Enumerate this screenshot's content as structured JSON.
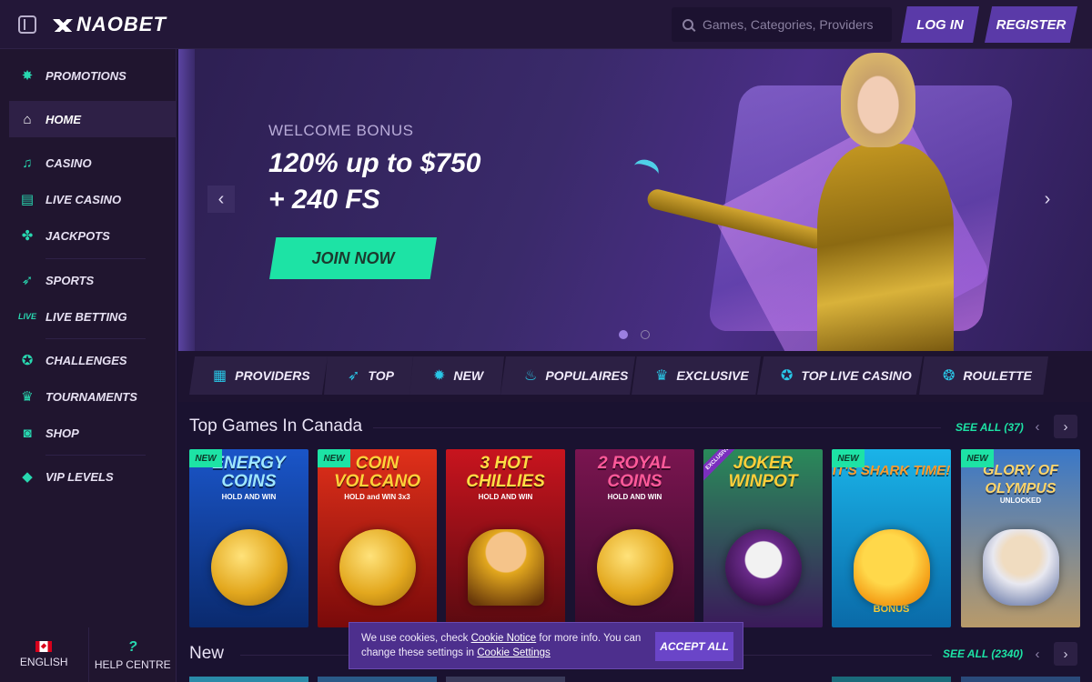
{
  "header": {
    "logo": "NAOBET",
    "search_placeholder": "Games, Categories, Providers",
    "login": "LOG IN",
    "register": "REGISTER"
  },
  "sidebar": {
    "items": [
      {
        "label": "PROMOTIONS",
        "icon": "promotions-icon"
      },
      {
        "label": "HOME",
        "icon": "home-icon"
      },
      {
        "label": "CASINO",
        "icon": "music-note-icon"
      },
      {
        "label": "LIVE CASINO",
        "icon": "cards-icon"
      },
      {
        "label": "JACKPOTS",
        "icon": "clover-icon"
      },
      {
        "label": "SPORTS",
        "icon": "sneaker-icon"
      },
      {
        "label": "LIVE BETTING",
        "icon": "live-icon"
      },
      {
        "label": "CHALLENGES",
        "icon": "medal-icon"
      },
      {
        "label": "TOURNAMENTS",
        "icon": "trophy-icon"
      },
      {
        "label": "SHOP",
        "icon": "shopping-bag-icon"
      },
      {
        "label": "VIP LEVELS",
        "icon": "diamond-icon"
      }
    ],
    "footer": {
      "language": "ENGLISH",
      "help": "HELP CENTRE"
    }
  },
  "hero": {
    "kicker": "WELCOME BONUS",
    "title_line1": "120% up to $750",
    "title_line2": "+ 240 FS",
    "cta": "JOIN NOW",
    "slide": 1,
    "slides": 2
  },
  "categories": [
    {
      "label": "PROVIDERS",
      "icon": "grid-icon"
    },
    {
      "label": "TOP",
      "icon": "rocket-icon"
    },
    {
      "label": "NEW",
      "icon": "new-badge-icon"
    },
    {
      "label": "POPULAIRES",
      "icon": "flame-icon"
    },
    {
      "label": "EXCLUSIVE",
      "icon": "crown-icon"
    },
    {
      "label": "TOP LIVE CASINO",
      "icon": "chip-icon"
    },
    {
      "label": "ROULETTE",
      "icon": "roulette-icon"
    }
  ],
  "sections": {
    "top": {
      "title": "Top Games In Canada",
      "see_all": "SEE ALL (37)"
    },
    "new": {
      "title": "New",
      "see_all": "SEE ALL (2340)"
    }
  },
  "games": [
    {
      "name": "ENERGY COINS",
      "sub": "HOLD AND WIN",
      "badge": "NEW",
      "colors": [
        "#1a55c8",
        "#0a2a6e"
      ],
      "title_color": "#9fe7ff"
    },
    {
      "name": "COIN VOLCANO",
      "sub": "HOLD and WIN 3x3",
      "badge": "NEW",
      "colors": [
        "#e0301a",
        "#7a0a0a"
      ],
      "title_color": "#ffd23a"
    },
    {
      "name": "3 HOT CHILLIES",
      "sub": "HOLD AND WIN",
      "badge": "",
      "colors": [
        "#c8141e",
        "#5a0a10"
      ],
      "title_color": "#ffdd44"
    },
    {
      "name": "2 ROYAL COINS",
      "sub": "HOLD AND WIN",
      "badge": "",
      "colors": [
        "#7a1550",
        "#3a0a2a"
      ],
      "title_color": "#ff5a9a"
    },
    {
      "name": "JOKER WINPOT",
      "sub": "",
      "badge": "EXCLUSIVE",
      "colors": [
        "#2a8a5a",
        "#3a1a5a"
      ],
      "title_color": "#ffcf3a"
    },
    {
      "name": "IT'S SHARK TIME!",
      "sub": "BONUS",
      "badge": "NEW",
      "colors": [
        "#1ab3e8",
        "#0a6aa8"
      ],
      "title_color": "#ff9a2a"
    },
    {
      "name": "GLORY OF OLYMPUS",
      "sub": "UNLOCKED",
      "badge": "NEW",
      "colors": [
        "#3a78c8",
        "#b89a6a"
      ],
      "title_color": "#ffd56a"
    }
  ],
  "cookie": {
    "text_before": "We use cookies, check ",
    "link1": "Cookie Notice",
    "text_middle": " for more info. You can change these settings in ",
    "link2": "Cookie Settings",
    "button": "ACCEPT ALL"
  },
  "colors": {
    "accent": "#1de3a5",
    "primary": "#5a3aa8",
    "background": "#1a1230"
  }
}
